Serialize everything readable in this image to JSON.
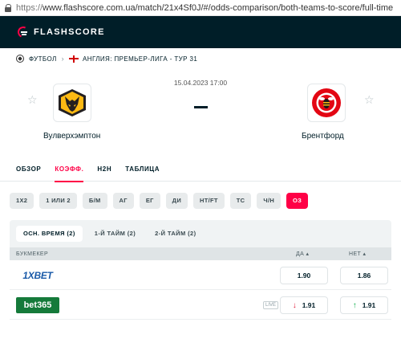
{
  "browser": {
    "url_proto": "https://",
    "url_rest": "www.flashscore.com.ua/match/21x4Sf0J/#/odds-comparison/both-teams-to-score/full-time"
  },
  "header": {
    "logo_text": "FLASHSCORE"
  },
  "breadcrumb": {
    "sport": "ФУТБОЛ",
    "league": "АНГЛИЯ: ПРЕМЬЕР-ЛИГА - ТУР 31"
  },
  "match": {
    "datetime": "15.04.2023 17:00",
    "home_team": "Вулверхэмптон",
    "away_team": "Брентфорд"
  },
  "tabs": [
    "ОБЗОР",
    "КОЭФФ.",
    "H2H",
    "ТАБЛИЦА"
  ],
  "bet_types": [
    "1X2",
    "1 ИЛИ 2",
    "Б/М",
    "АГ",
    "ЕГ",
    "ДИ",
    "HT/FT",
    "ТС",
    "Ч/Н",
    "ОЗ"
  ],
  "periods": [
    "ОСН. ВРЕМЯ (2)",
    "1-Й ТАЙМ (2)",
    "2-Й ТАЙМ (2)"
  ],
  "table": {
    "col_bookmaker": "БУКМЕКЕР",
    "col_yes": "ДА ▴",
    "col_no": "НЕТ ▴",
    "rows": [
      {
        "bookmaker": "1XBET",
        "yes": "1.90",
        "no": "1.86"
      },
      {
        "bookmaker": "bet365",
        "live": "LIVE",
        "yes": "1.91",
        "no": "1.91",
        "yes_trend": "↓",
        "no_trend": "↑"
      }
    ]
  },
  "colors": {
    "accent": "#ff0046",
    "header_bg": "#001e28"
  }
}
